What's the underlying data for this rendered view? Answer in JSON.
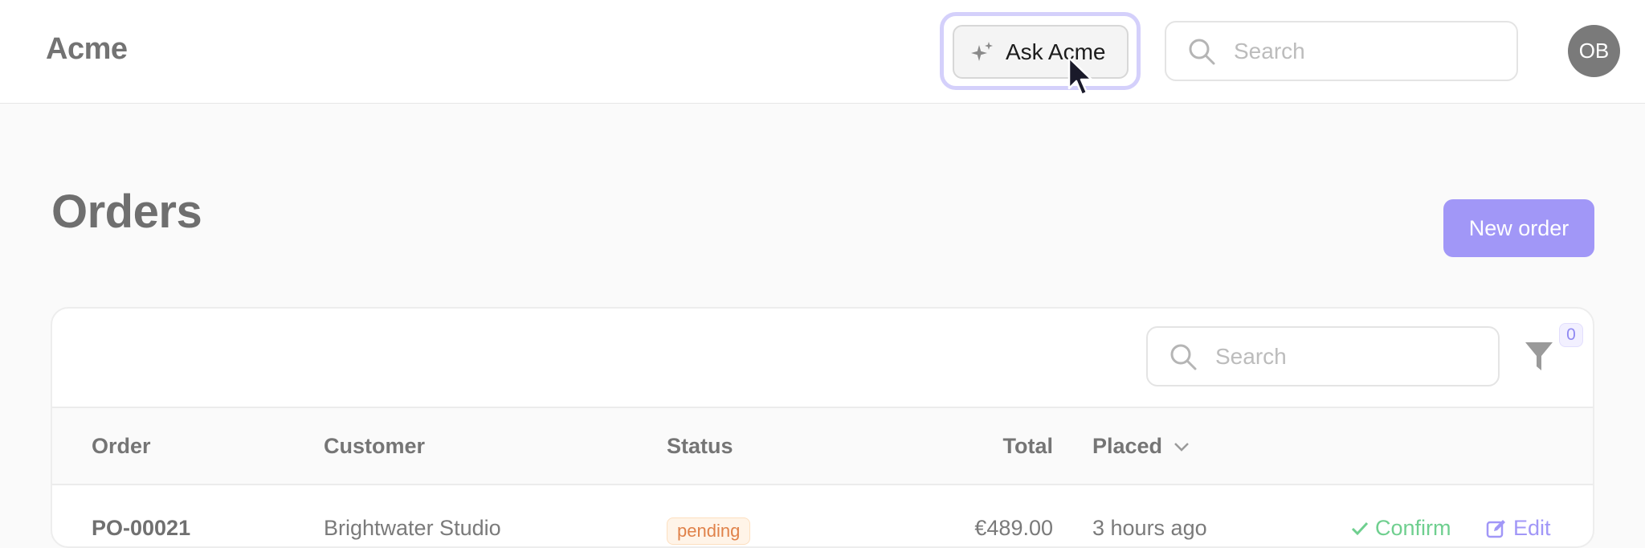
{
  "app": {
    "brand": "Acme"
  },
  "header": {
    "ask_label": "Ask Acme",
    "search_placeholder": "Search",
    "avatar_initials": "OB"
  },
  "page": {
    "title": "Orders",
    "new_button": "New order"
  },
  "table": {
    "search_placeholder": "Search",
    "filter_count": "0",
    "columns": {
      "order": "Order",
      "customer": "Customer",
      "status": "Status",
      "total": "Total",
      "placed": "Placed"
    },
    "rows": [
      {
        "order": "PO-00021",
        "customer": "Brightwater Studio",
        "status": "pending",
        "total": "€489.00",
        "placed": "3 hours ago",
        "confirm": "Confirm",
        "edit": "Edit"
      }
    ]
  },
  "colors": {
    "accent": "#a197f7",
    "focus_ring": "#d4d0fb",
    "confirm": "#6fcf8f",
    "pending_text": "#e0824a"
  },
  "icons": [
    "sparkles-icon",
    "search-icon",
    "filter-icon",
    "chevron-down-icon",
    "check-icon",
    "edit-icon",
    "cursor-icon"
  ]
}
